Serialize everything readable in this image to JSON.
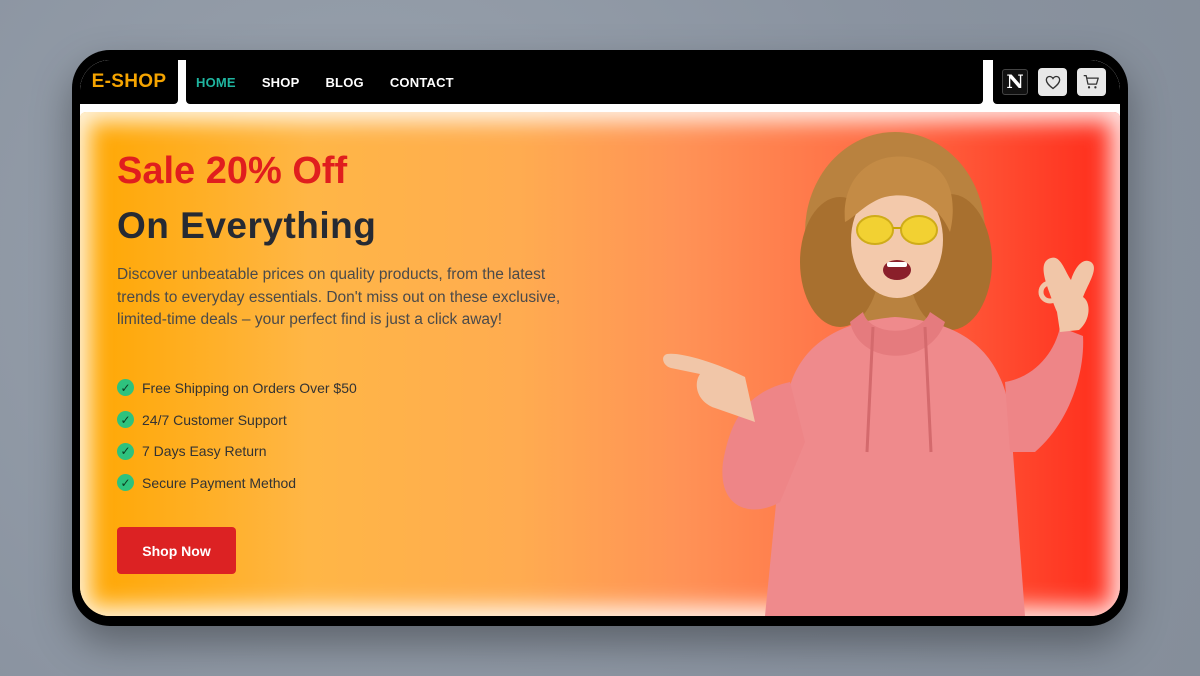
{
  "nav": {
    "brand": "E-SHOP",
    "items": [
      {
        "label": "HOME",
        "active": true
      },
      {
        "label": "SHOP",
        "active": false
      },
      {
        "label": "BLOG",
        "active": false
      },
      {
        "label": "CONTACT",
        "active": false
      }
    ],
    "icons": [
      "n-logo-icon",
      "heart-icon",
      "cart-icon"
    ],
    "n_letter": "N"
  },
  "hero": {
    "sale": "Sale 20% Off",
    "headline": "On Everything",
    "description": "Discover unbeatable prices on quality products, from the latest trends to everyday essentials. Don't miss out on these exclusive, limited-time deals – your perfect find is just a click away!",
    "features": [
      "Free Shipping on Orders Over $50",
      "24/7 Customer Support",
      "7 Days Easy Return",
      "Secure Payment Method"
    ],
    "cta": "Shop Now"
  },
  "colors": {
    "brand": "#f5a400",
    "active_nav": "#1fb5a0",
    "sale": "#e01e1e",
    "cta": "#dc2223",
    "check": "#2ec27e"
  }
}
